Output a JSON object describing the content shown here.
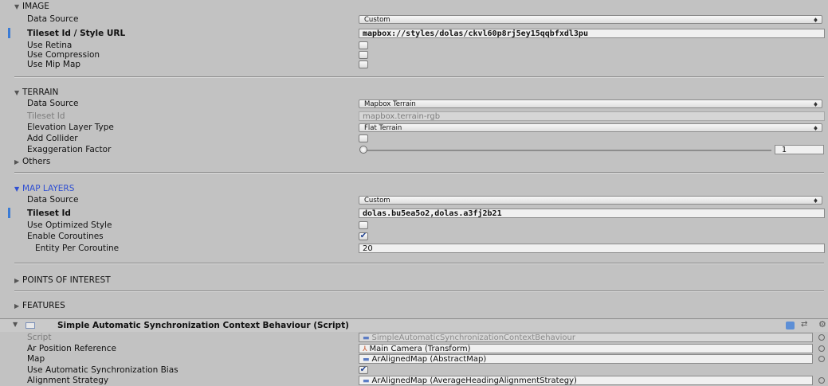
{
  "image_section": {
    "title": "IMAGE",
    "data_source_label": "Data Source",
    "data_source_value": "Custom",
    "tileset_label": "Tileset Id / Style URL",
    "tileset_value": "mapbox://styles/dolas/ckvl60p8rj5ey15qqbfxdl3pu",
    "use_retina_label": "Use Retina",
    "use_compression_label": "Use Compression",
    "use_mip_map_label": "Use Mip Map"
  },
  "terrain_section": {
    "title": "TERRAIN",
    "data_source_label": "Data Source",
    "data_source_value": "Mapbox Terrain",
    "tileset_label": "Tileset Id",
    "tileset_value": "mapbox.terrain-rgb",
    "elevation_label": "Elevation Layer Type",
    "elevation_value": "Flat Terrain",
    "add_collider_label": "Add Collider",
    "exaggeration_label": "Exaggeration Factor",
    "exaggeration_value": "1",
    "others_label": "Others"
  },
  "map_layers_section": {
    "title": "MAP LAYERS",
    "data_source_label": "Data Source",
    "data_source_value": "Custom",
    "tileset_label": "Tileset Id",
    "tileset_value": "dolas.bu5ea5o2,dolas.a3fj2b21",
    "optimized_style_label": "Use Optimized Style",
    "enable_coroutines_label": "Enable Coroutines",
    "entity_per_coroutine_label": "Entity Per Coroutine",
    "entity_per_coroutine_value": "20"
  },
  "collapsed_sections": {
    "points_of_interest": "POINTS OF INTEREST",
    "features": "FEATURES"
  },
  "component": {
    "title": "Simple Automatic Synchronization Context Behaviour (Script)",
    "script_label": "Script",
    "script_value": "SimpleAutomaticSynchronizationContextBehaviour",
    "ar_position_label": "Ar Position Reference",
    "ar_position_value": "Main Camera (Transform)",
    "map_label": "Map",
    "map_value": "ArAlignedMap (AbstractMap)",
    "sync_bias_label": "Use Automatic Synchronization Bias",
    "alignment_label": "Alignment Strategy",
    "alignment_value": "ArAlignedMap (AverageHeadingAlignmentStrategy)"
  },
  "checkbox_states": {
    "enable_coroutines": true,
    "use_automatic_sync_bias": true
  },
  "glyphs": {
    "expanded": "▼",
    "collapsed": "▶",
    "dropdown_arrow": "♦",
    "check": "✔",
    "script_icon": "▬",
    "camera_icon": "⅄"
  },
  "icons": [
    "expand-triangle-icon",
    "collapse-triangle-icon",
    "dropdown-arrow-icon",
    "checkmark-icon",
    "script-icon",
    "help-icon",
    "settings-icon",
    "gear-icon",
    "object-picker-icon"
  ],
  "colors": {
    "panel_bg": "#c2c2c2",
    "selected_section": "#2f4fd2",
    "selection_bar": "#3a7bd5"
  }
}
